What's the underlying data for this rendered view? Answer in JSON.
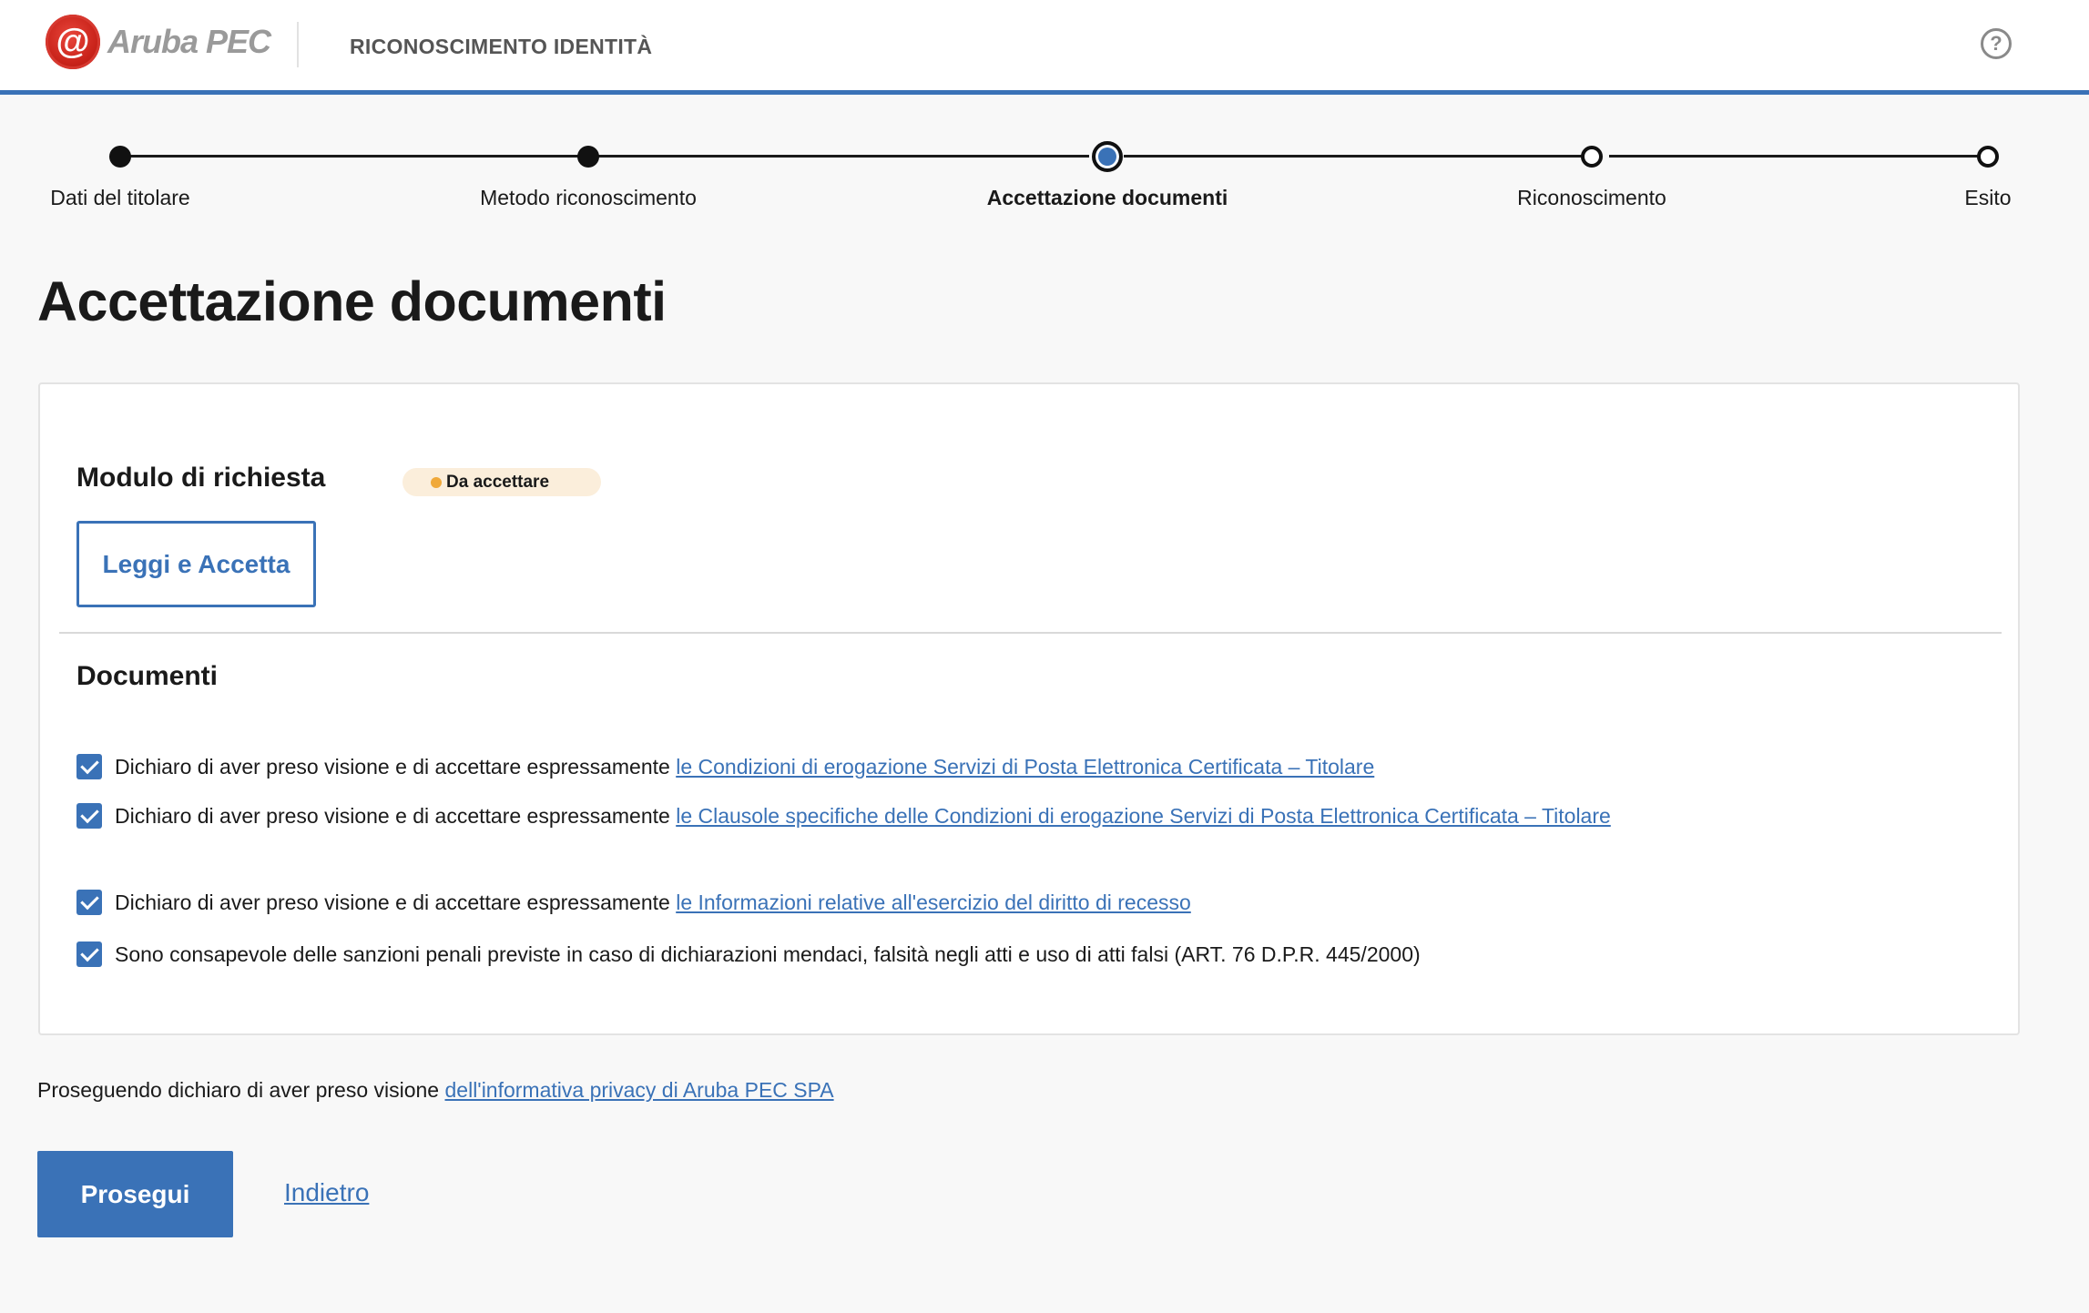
{
  "header": {
    "logo_text": "Aruba PEC",
    "logo_symbol": "@",
    "title": "RICONOSCIMENTO IDENTITÀ",
    "help_icon": "?"
  },
  "stepper": {
    "steps": [
      {
        "label": "Dati del titolare",
        "state": "done"
      },
      {
        "label": "Metodo riconoscimento",
        "state": "done"
      },
      {
        "label": "Accettazione documenti",
        "state": "current"
      },
      {
        "label": "Riconoscimento",
        "state": "todo"
      },
      {
        "label": "Esito",
        "state": "todo"
      }
    ]
  },
  "page": {
    "title": "Accettazione documenti"
  },
  "module": {
    "heading": "Modulo di richiesta",
    "badge": "Da accettare",
    "badge_color": "#f0a93a",
    "button_label": "Leggi e Accetta"
  },
  "documents": {
    "heading": "Documenti",
    "items": [
      {
        "checked": true,
        "prefix": "Dichiaro di aver preso visione e di accettare espressamente ",
        "link": "le Condizioni di erogazione Servizi di Posta Elettronica Certificata – Titolare"
      },
      {
        "checked": true,
        "prefix": "Dichiaro di aver preso visione e di accettare espressamente ",
        "link": "le Clausole specifiche delle Condizioni di erogazione Servizi di Posta Elettronica Certificata – Titolare"
      },
      {
        "checked": true,
        "prefix": "Dichiaro di aver preso visione e di accettare espressamente ",
        "link": "le Informazioni relative all'esercizio del diritto di recesso"
      },
      {
        "checked": true,
        "prefix": "Sono consapevole delle sanzioni penali previste in caso di dichiarazioni mendaci, falsità negli atti e uso di atti falsi (ART. 76 D.P.R. 445/2000)",
        "link": ""
      }
    ]
  },
  "footer": {
    "privacy_prefix": "Proseguendo dichiaro di aver preso visione ",
    "privacy_link": "dell'informativa privacy di Aruba PEC SPA",
    "primary_button": "Prosegui",
    "back_link": "Indietro"
  },
  "colors": {
    "accent": "#3a72b7",
    "badge_bg": "#fbeedb",
    "logo_red": "#c9231a"
  }
}
